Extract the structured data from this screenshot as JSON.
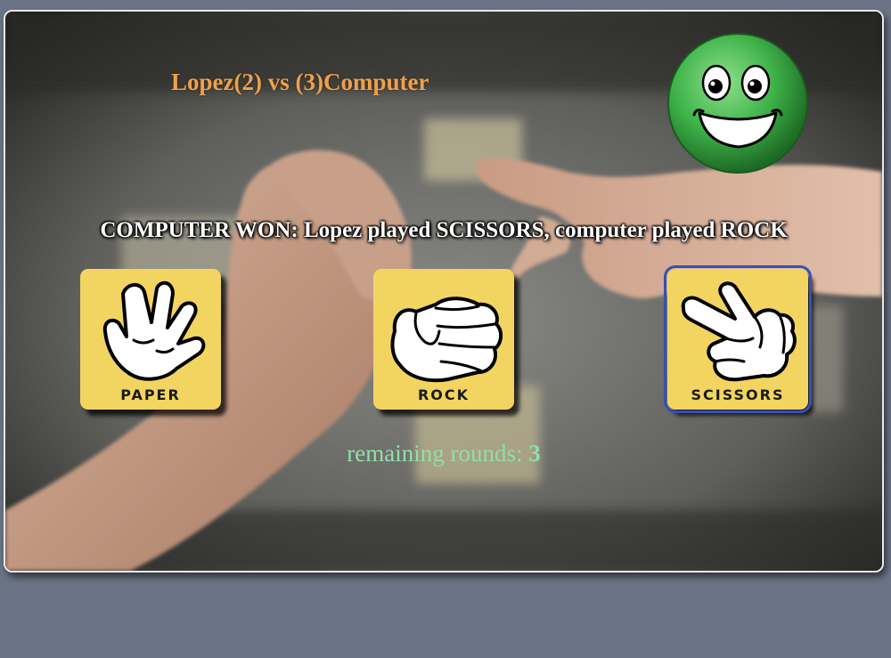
{
  "game": {
    "player_name": "Lopez",
    "player_score": "2",
    "computer_score": "3",
    "computer_name": "Computer",
    "scoreline": "Lopez(2) vs (3)Computer",
    "result_message": "COMPUTER WON: Lopez played SCISSORS, computer played ROCK",
    "rounds_label": "remaining rounds: ",
    "rounds_remaining": "3"
  },
  "choices": [
    {
      "id": "paper",
      "label": "PAPER",
      "icon": "open-hand-icon",
      "selected": false
    },
    {
      "id": "rock",
      "label": "ROCK",
      "icon": "fist-icon",
      "selected": false
    },
    {
      "id": "scissors",
      "label": "SCISSORS",
      "icon": "scissors-hand-icon",
      "selected": true
    }
  ],
  "mood_icon": "happy-smiley-icon",
  "colors": {
    "page_bg": "#6b7486",
    "score_text": "#f0a04a",
    "rounds_text": "#8fe0a8",
    "card_bg": "#f2d460",
    "selected_outline": "#3550b8",
    "smiley_green": "#3fb34a"
  }
}
